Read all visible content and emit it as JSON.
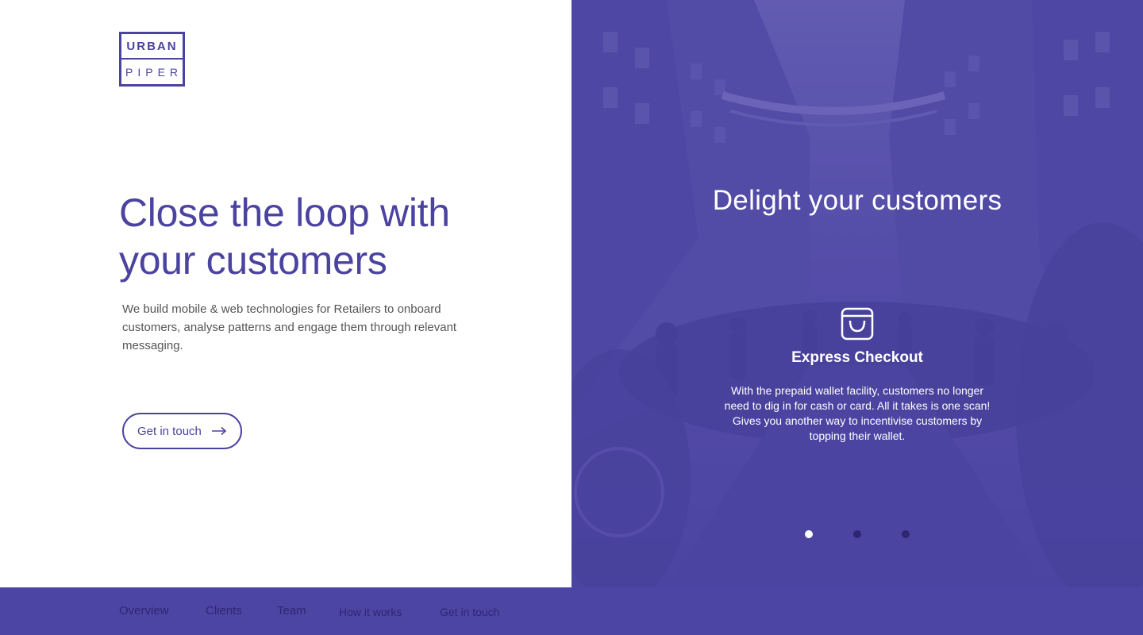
{
  "logo": {
    "top": "URBAN",
    "bottom": "PIPER"
  },
  "hero": {
    "headline": "Close the loop with your customers",
    "subtext": "We build mobile & web technologies for Retailers to onboard customers, analyse patterns and engage them through relevant messaging.",
    "cta_label": "Get in touch",
    "cta_icon": "arrow-right-icon"
  },
  "slider": {
    "title": "Delight your customers",
    "feature_icon": "shopping-bag-icon",
    "feature_title": "Express Checkout",
    "feature_desc": "With the prepaid wallet facility, customers no longer need to dig in for cash or card. All it takes is one scan! Gives you another way to incentivise customers by topping their wallet.",
    "active_dot": 1,
    "dot_count": 3
  },
  "nav": {
    "items": [
      "Overview",
      "Clients",
      "Team",
      "How it works",
      "Get in touch"
    ]
  },
  "colors": {
    "brand": "#4a43a0",
    "panel": "#4d45a3",
    "nav_text": "#2d2773",
    "text_muted": "#555555"
  }
}
